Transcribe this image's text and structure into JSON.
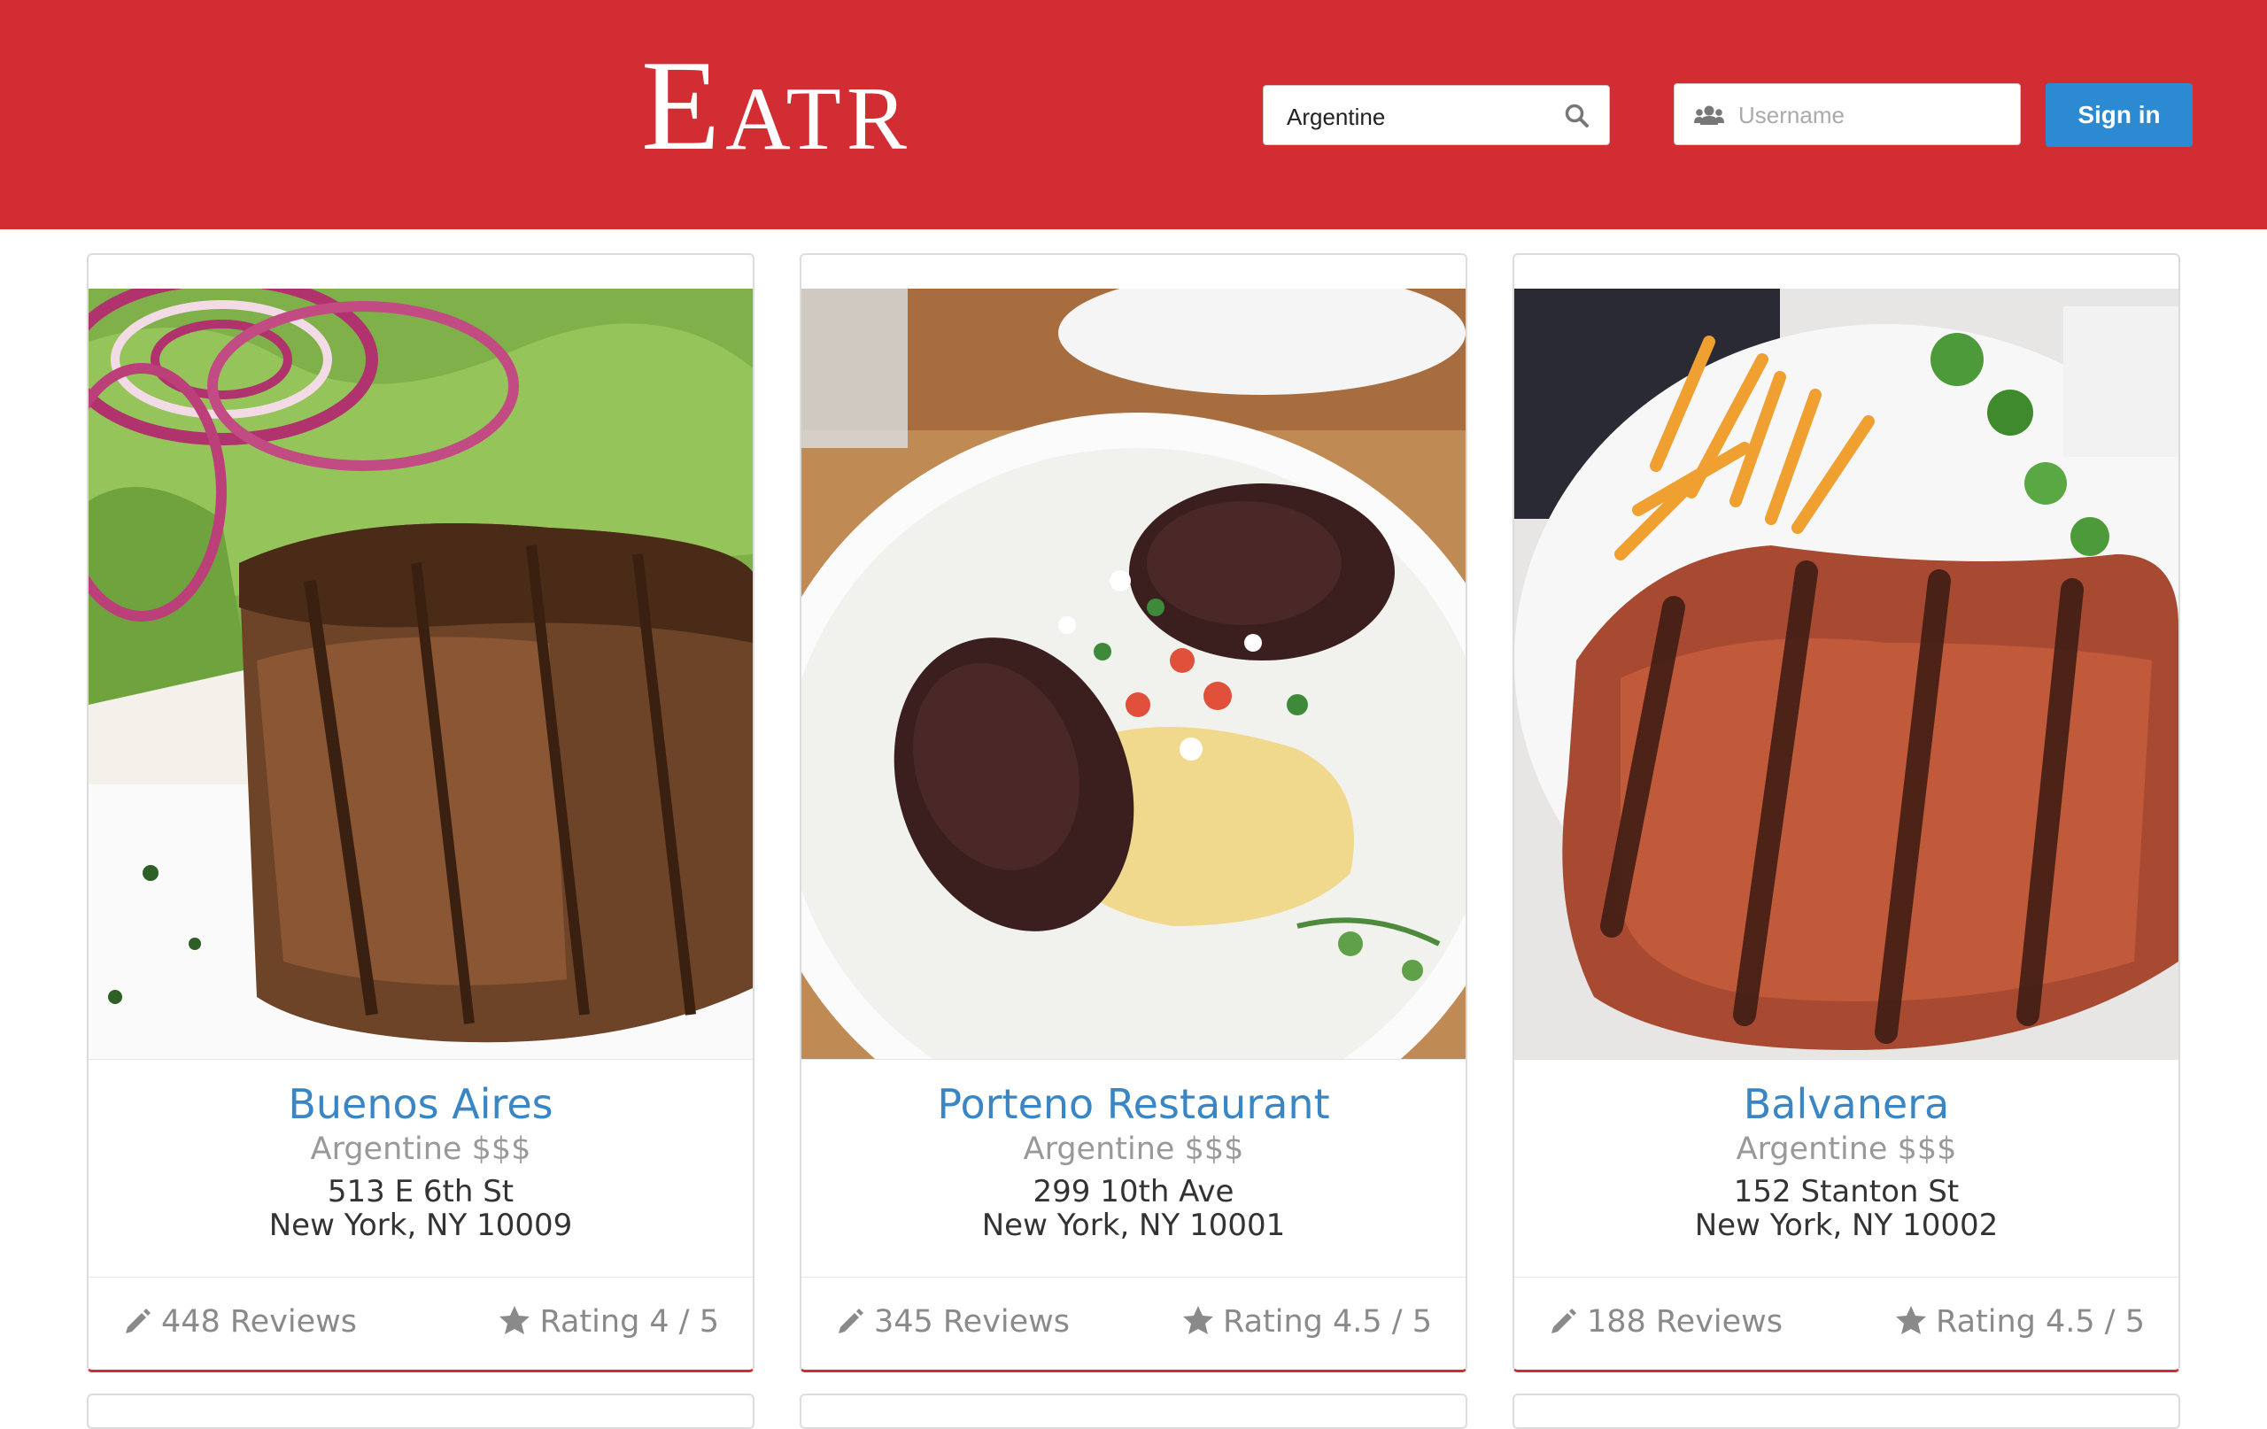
{
  "app": {
    "logo": "Eatr",
    "brand_color": "#d12d33",
    "accent_color": "#2c8ad3"
  },
  "header": {
    "search": {
      "value": "Argentine",
      "icon": "search-icon"
    },
    "username": {
      "placeholder": "Username",
      "icon": "users-icon"
    },
    "signin_label": "Sign in"
  },
  "restaurants": [
    {
      "name": "Buenos Aires",
      "cuisine": "Argentine $$$",
      "address_line1": "513 E 6th St",
      "address_line2": "New York, NY 10009",
      "reviews": "448 Reviews",
      "rating": "Rating 4 / 5",
      "photo": "grilled-filet-steak-photo"
    },
    {
      "name": "Porteno Restaurant",
      "cuisine": "Argentine $$$",
      "address_line1": "299 10th Ave",
      "address_line2": "New York, NY 10001",
      "reviews": "345 Reviews",
      "rating": "Rating 4.5 / 5",
      "photo": "blood-sausage-dish-photo"
    },
    {
      "name": "Balvanera",
      "cuisine": "Argentine $$$",
      "address_line1": "152 Stanton St",
      "address_line2": "New York, NY 10002",
      "reviews": "188 Reviews",
      "rating": "Rating 4.5 / 5",
      "photo": "grilled-steak-fries-photo"
    }
  ]
}
